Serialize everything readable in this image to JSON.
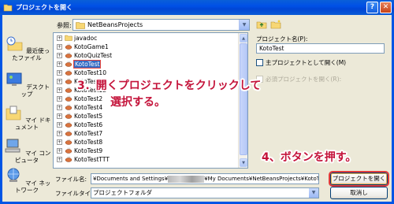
{
  "window": {
    "title": "プロジェクトを開く"
  },
  "toolbar": {
    "look_in_label": "参照:",
    "look_in_value": "NetBeansProjects"
  },
  "places": [
    {
      "label": "最近使ったファイル",
      "icon": "recent-icon"
    },
    {
      "label": "デスクトップ",
      "icon": "desktop-icon"
    },
    {
      "label": "マイ ドキュメント",
      "icon": "my-documents-icon"
    },
    {
      "label": "マイ コンピュータ",
      "icon": "my-computer-icon"
    },
    {
      "label": "マイ ネットワーク",
      "icon": "network-icon"
    }
  ],
  "file_list": [
    {
      "name": "javadoc",
      "type": "folder"
    },
    {
      "name": "KotoGame1",
      "type": "project"
    },
    {
      "name": "KotoQuizTest",
      "type": "project"
    },
    {
      "name": "KotoTest",
      "type": "project",
      "selected": true
    },
    {
      "name": "KotoTest10",
      "type": "project"
    },
    {
      "name": "KotoTest11",
      "type": "project"
    },
    {
      "name": "KotoTest12",
      "type": "project"
    },
    {
      "name": "KotoTest2",
      "type": "project"
    },
    {
      "name": "KotoTest4",
      "type": "project"
    },
    {
      "name": "KotoTest5",
      "type": "project"
    },
    {
      "name": "KotoTest6",
      "type": "project"
    },
    {
      "name": "KotoTest7",
      "type": "project"
    },
    {
      "name": "KotoTest8",
      "type": "project"
    },
    {
      "name": "KotoTest9",
      "type": "project"
    },
    {
      "name": "KotoTestTTT",
      "type": "project"
    }
  ],
  "right_panel": {
    "project_name_label": "プロジェクト名(P):",
    "project_name_value": "KotoTest",
    "main_project_checkbox": "主プロジェクトとして開く(M)",
    "required_projects_checkbox": "必須プロジェクトを開く(R):"
  },
  "bottom": {
    "file_name_label": "ファイル名:",
    "file_name_prefix": "¥Documents and Settings¥",
    "file_name_suffix": "¥My Documents¥NetBeansProjects¥KotoTest",
    "file_type_label": "ファイルタイプ:",
    "file_type_value": "プロジェクトフォルダ"
  },
  "buttons": {
    "open": "プロジェクトを開く",
    "cancel": "取消し"
  },
  "annotations": {
    "step3_line1": "3．開くプロジェクトをクリックして",
    "step3_line2": "選択する。",
    "step4": "4、ボタンを押す。"
  },
  "colors": {
    "titlebar": "#0050E6",
    "annotation": "#C4133A",
    "selection": "#316AC5"
  }
}
